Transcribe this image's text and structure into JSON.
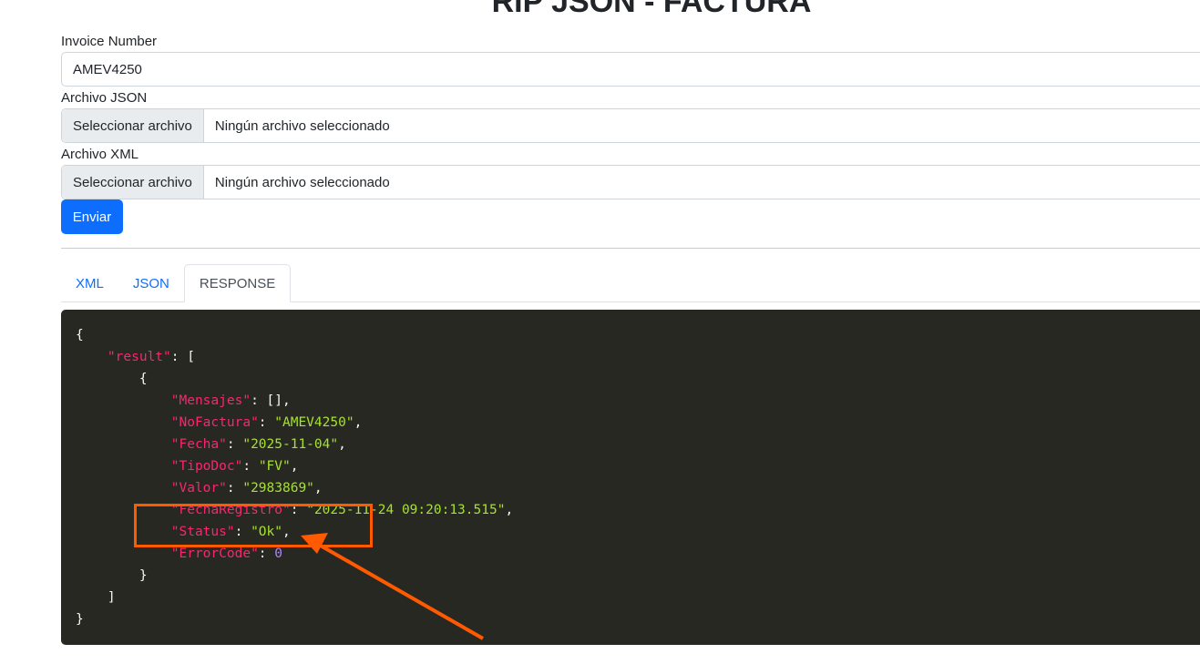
{
  "title": "RIP JSON - FACTURA",
  "invoice": {
    "label": "Invoice Number",
    "value": "AMEV4250"
  },
  "json_file": {
    "label": "Archivo JSON",
    "button": "Seleccionar archivo",
    "status": "Ningún archivo seleccionado"
  },
  "xml_file": {
    "label": "Archivo XML",
    "button": "Seleccionar archivo",
    "status": "Ningún archivo seleccionado"
  },
  "submit": "Enviar",
  "tabs": [
    {
      "label": "XML"
    },
    {
      "label": "JSON"
    },
    {
      "label": "RESPONSE",
      "active": true
    }
  ],
  "response": {
    "result_key": "\"result\"",
    "fields": [
      {
        "key": "\"Mensajes\"",
        "value": "[]",
        "type": "plain",
        "comma": true
      },
      {
        "key": "\"NoFactura\"",
        "value": "\"AMEV4250\"",
        "type": "string",
        "comma": true
      },
      {
        "key": "\"Fecha\"",
        "value": "\"2025-11-04\"",
        "type": "string",
        "comma": true
      },
      {
        "key": "\"TipoDoc\"",
        "value": "\"FV\"",
        "type": "string",
        "comma": true
      },
      {
        "key": "\"Valor\"",
        "value": "\"2983869\"",
        "type": "string",
        "comma": true
      },
      {
        "key": "\"FechaRegistro\"",
        "value": "\"2025-11-24 09:20:13.515\"",
        "type": "string",
        "comma": true
      },
      {
        "key": "\"Status\"",
        "value": "\"Ok\"",
        "type": "string",
        "comma": true
      },
      {
        "key": "\"ErrorCode\"",
        "value": "0",
        "type": "number",
        "comma": false
      }
    ]
  },
  "colors": {
    "accent": "#0d6efd",
    "code_bg": "#272822",
    "key": "#f92672",
    "string": "#a6e22e",
    "number": "#ae81ff",
    "annotation": "#ff5a00"
  }
}
